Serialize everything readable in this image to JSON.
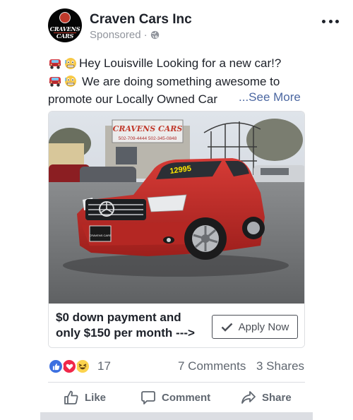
{
  "post": {
    "page_name": "Craven Cars Inc",
    "sponsored_label": "Sponsored",
    "meta_separator": "·",
    "avatar_text": "CRAVENS CARS",
    "text_lines": [
      "Hey Louisville Looking for a new car!?",
      "We are doing something awesome to",
      "promote our Locally Owned Car"
    ],
    "see_more": "...See More"
  },
  "ad": {
    "photo": {
      "sign_name": "CRAVENS CARS",
      "sign_phones": "502-709-4444  502-345-0848",
      "windshield_price": "12995",
      "plate_text": "CRAVENS CARS"
    },
    "headline": "$0 down payment and only $150 per month --->",
    "cta_label": "Apply Now"
  },
  "engagement": {
    "reaction_count": "17",
    "comments": "7 Comments",
    "shares": "3 Shares"
  },
  "actions": {
    "like": "Like",
    "comment": "Comment",
    "share": "Share"
  },
  "icons": [
    "globe-icon",
    "more-icon",
    "car-emoji",
    "grimace-emoji",
    "like-reaction-icon",
    "love-reaction-icon",
    "haha-reaction-icon",
    "check-icon",
    "thumbs-up-icon",
    "comment-icon",
    "share-icon"
  ],
  "colors": {
    "link": "#4b67a1",
    "secondary_text": "#606770",
    "like_blue": "#3b6fe0",
    "love_red": "#f0284a",
    "haha_yellow": "#fcd34d",
    "car_red": "#c8302e"
  }
}
